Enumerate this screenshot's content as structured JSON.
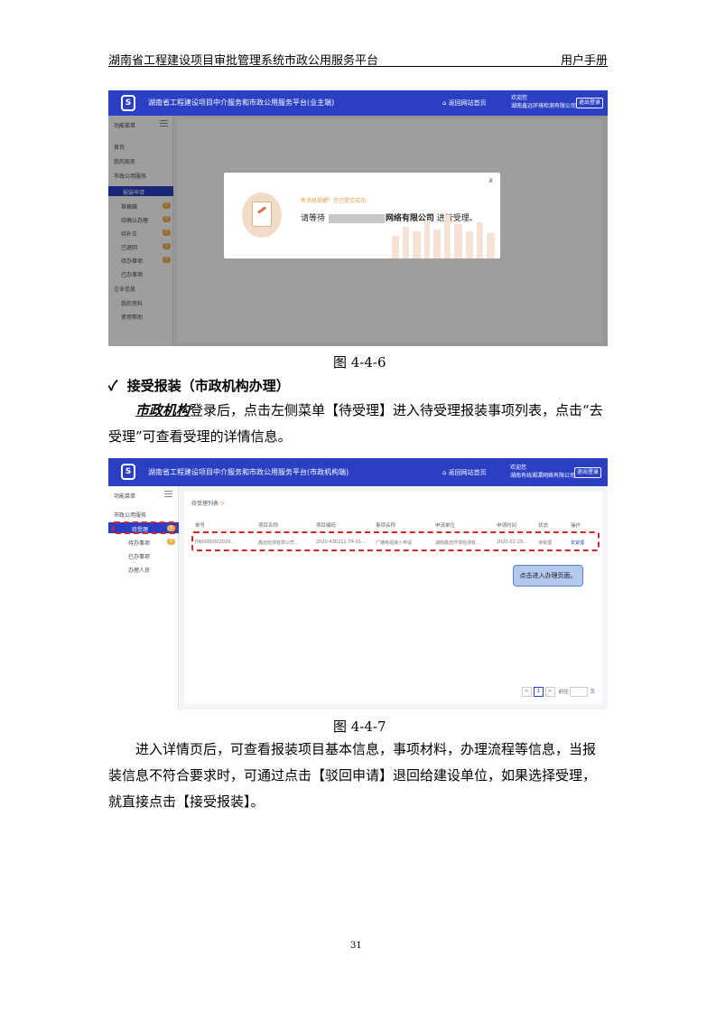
{
  "header": {
    "title": "湖南省工程建设项目审批管理系统市政公用服务平台",
    "manual": "用户手册"
  },
  "fig1": {
    "app_title": "湖南省工程建设项目中介服务和市政公用服务平台(业主端)",
    "home": "返回网站首页",
    "welcome_line1": "欢迎您",
    "welcome_line2": "湖南鑫远环境检测有限公司",
    "logout": "退出登录",
    "sidebar_title": "功能菜单",
    "sidebar_items": [
      "首页",
      "我的商务",
      "市政公用服务",
      "报装申请",
      "草稿箱",
      "待确认办理",
      "待补正",
      "已退回",
      "待办事项",
      "已办事项",
      "企业信息",
      "我的资料",
      "使用帮助"
    ],
    "sidebar_counts": [
      "0",
      "0",
      "0",
      "0",
      "0"
    ],
    "modal_hint": "新消息提醒！您已提交成功",
    "modal_msg_prefix": "请等待",
    "modal_msg_company": "网络有限公司",
    "modal_msg_suffix": "进行受理。",
    "close": "x"
  },
  "caption1": "图 4-4-6",
  "section_title": "接受报装（市政机构办理）",
  "para1_em": "市政机构",
  "para1_rest": "登录后，点击左侧菜单【待受理】进入待受理报装事项列表，点击“去受理”可查看受理的详情信息。",
  "fig2": {
    "app_title": "湖南省工程建设项目中介服务和市政公用服务平台(市政机构端)",
    "home": "返回网站首页",
    "welcome_line1": "欢迎您",
    "welcome_line2": "湖南有线湘潭网络有限公司",
    "logout": "退出登录",
    "sidebar_title": "功能菜单",
    "sidebar_group": "市政公用服务",
    "sidebar_items": [
      "待受理",
      "待办事项",
      "已办事项",
      "办理人员"
    ],
    "sidebar_counts": [
      "1",
      "0"
    ],
    "panel_title": "待受理列表",
    "columns": [
      "单号",
      "项目名称",
      "项目编码",
      "事项名称",
      "申请单位",
      "申请时间",
      "状态",
      "操作"
    ],
    "row": [
      "HN0000002020...",
      "鑫远检测有限公司...",
      "2020-430211-74-01-...",
      "广播电视接入申请",
      "湖南鑫远环境检测有...",
      "2020-02-29...",
      "待受理",
      "去受理"
    ],
    "tip": "点击进入办理页面。",
    "page_current": "1",
    "page_prev": "<",
    "page_next": ">",
    "page_go": "前往",
    "page_unit": "页"
  },
  "caption2": "图 4-4-7",
  "para2": "进入详情页后，可查看报装项目基本信息，事项材料，办理流程等信息，当报装信息不符合要求时，可通过点击【驳回申请】退回给建设单位，如果选择受理，就直接点击【接受报装】。",
  "page_number": "31",
  "colors": {
    "primary": "#2a3fc4",
    "warning": "#f0ad4e",
    "highlight": "#d9262b",
    "tip_bg": "#b4c9ee"
  },
  "icons": [
    "checkmark-icon",
    "app-logo-icon",
    "home-icon",
    "hamburger-icon",
    "document-icon"
  ]
}
